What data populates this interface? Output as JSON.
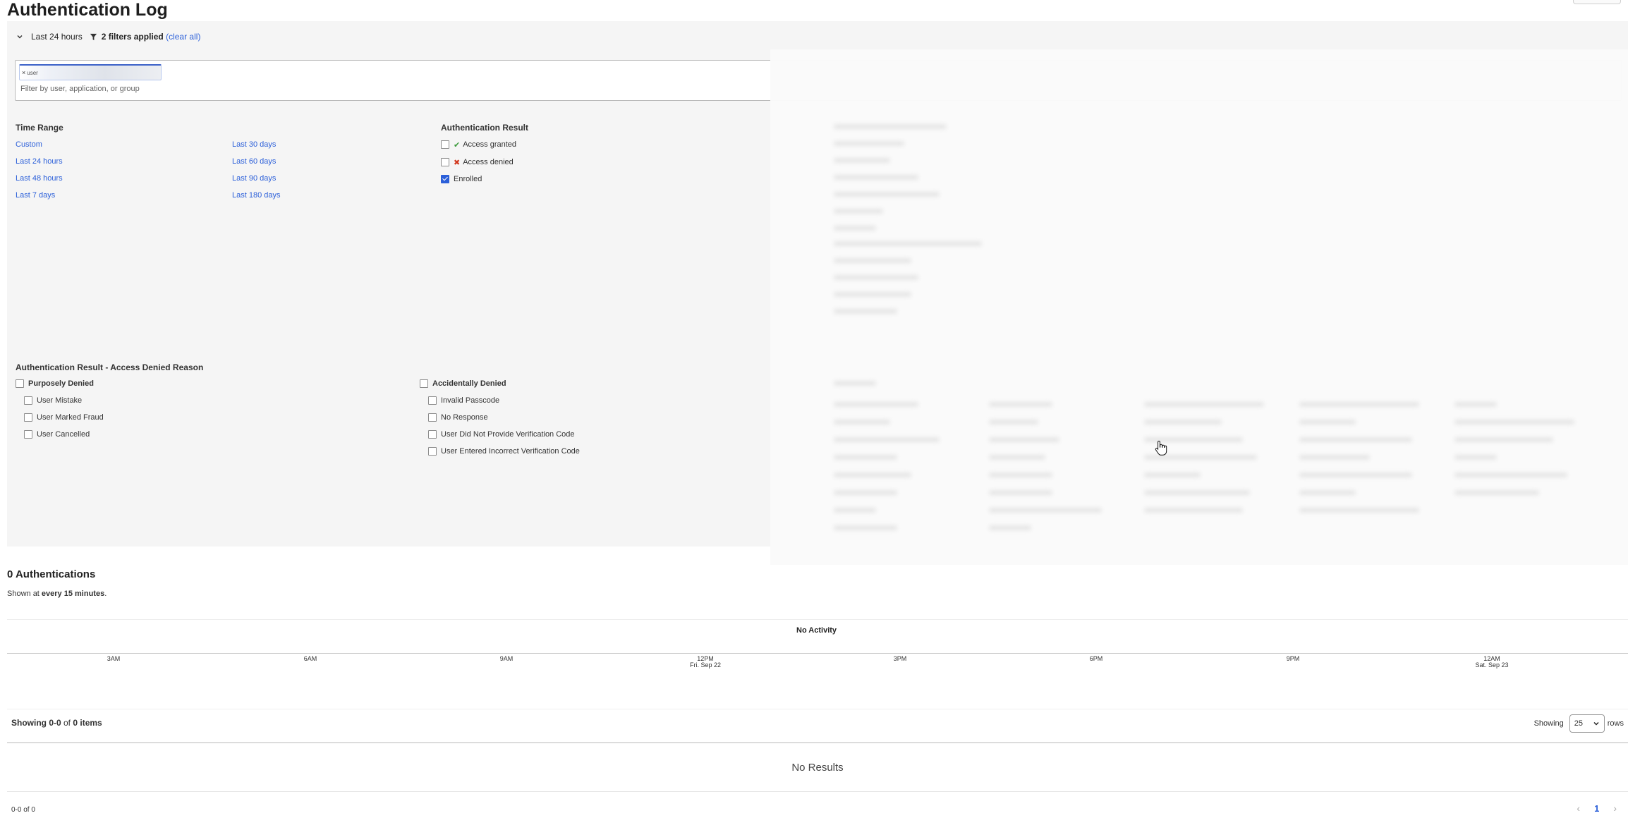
{
  "page": {
    "title": "Authentication Log"
  },
  "filters": {
    "time_label": "Last 24 hours",
    "applied_text": "2 filters applied",
    "clear_text": "(clear all)",
    "chip_text": "user",
    "placeholder": "Filter by user, application, or group"
  },
  "time_range": {
    "title": "Time Range",
    "col1": [
      "Custom",
      "Last 24 hours",
      "Last 48 hours",
      "Last 7 days"
    ],
    "col2": [
      "Last 30 days",
      "Last 60 days",
      "Last 90 days",
      "Last 180 days"
    ]
  },
  "auth_result": {
    "title": "Authentication Result",
    "options": [
      {
        "label": "Access granted",
        "checked": false,
        "icon": "check-icon"
      },
      {
        "label": "Access denied",
        "checked": false,
        "icon": "cross-icon"
      },
      {
        "label": "Enrolled",
        "checked": true,
        "icon": ""
      }
    ]
  },
  "denied_reason": {
    "title": "Authentication Result - Access Denied Reason",
    "purposely": {
      "label": "Purposely Denied",
      "items": [
        "User Mistake",
        "User Marked Fraud",
        "User Cancelled"
      ]
    },
    "accidentally": {
      "label": "Accidentally Denied",
      "items": [
        "Invalid Passcode",
        "No Response",
        "User Did Not Provide Verification Code",
        "User Entered Incorrect Verification Code"
      ]
    }
  },
  "summary": {
    "count_label": "0 Authentications",
    "shown_prefix": "Shown at ",
    "shown_interval": "every 15 minutes",
    "shown_suffix": "."
  },
  "timeline": {
    "no_activity": "No Activity",
    "ticks": [
      {
        "time": "3AM",
        "date": ""
      },
      {
        "time": "6AM",
        "date": ""
      },
      {
        "time": "9AM",
        "date": ""
      },
      {
        "time": "12PM",
        "date": "Fri. Sep 22"
      },
      {
        "time": "3PM",
        "date": ""
      },
      {
        "time": "6PM",
        "date": ""
      },
      {
        "time": "9PM",
        "date": ""
      },
      {
        "time": "12AM",
        "date": "Sat. Sep 23"
      }
    ]
  },
  "results": {
    "showing_prefix": "Showing ",
    "showing_range": "0-0",
    "showing_mid": " of ",
    "showing_total": "0 items",
    "rows_label_pre": "Showing",
    "rows_value": "25",
    "rows_label_post": "rows",
    "no_results": "No Results",
    "page_range": "0-0 of 0",
    "current_page": "1"
  },
  "colors": {
    "link": "#2b5fd9",
    "panel_bg": "#f5f5f5",
    "check": "#3a9a3a",
    "cross": "#d2371d"
  }
}
